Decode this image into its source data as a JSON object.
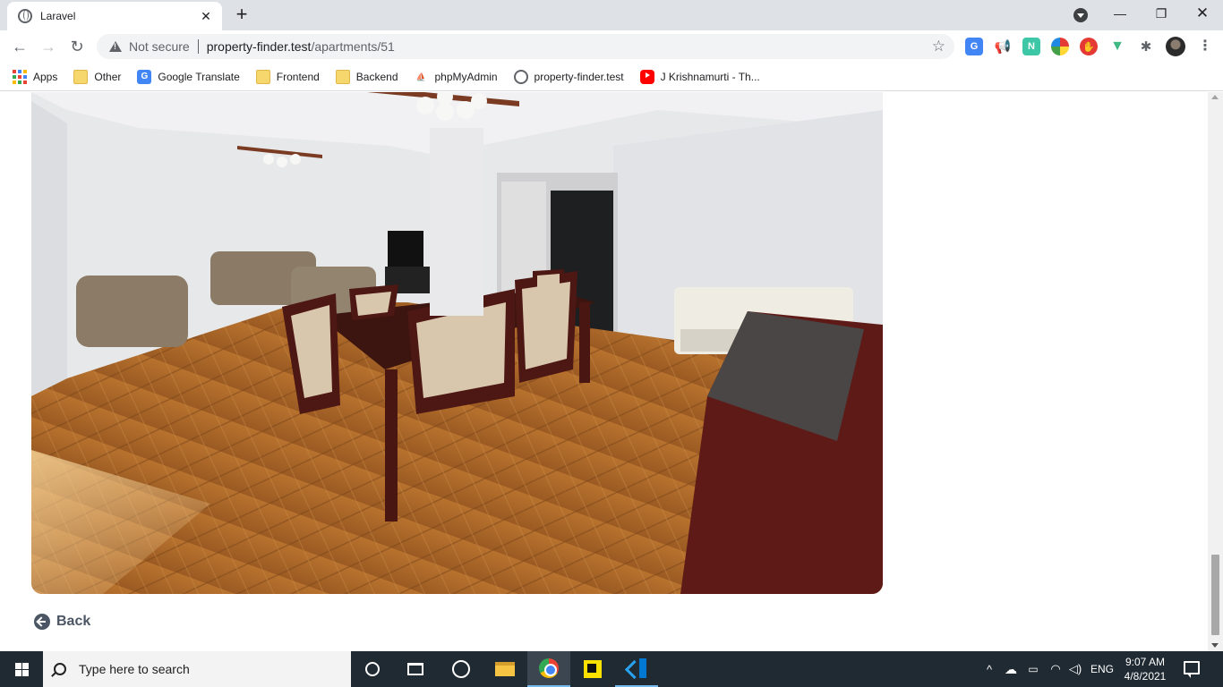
{
  "browser": {
    "tab_title": "Laravel",
    "address": {
      "security_label": "Not secure",
      "host": "property-finder.test",
      "path": "/apartments/51"
    },
    "bookmarks": [
      {
        "label": "Apps",
        "icon": "apps-grid-icon"
      },
      {
        "label": "Other",
        "icon": "folder-icon"
      },
      {
        "label": "Google Translate",
        "icon": "google-translate-icon"
      },
      {
        "label": "Frontend",
        "icon": "folder-icon"
      },
      {
        "label": "Backend",
        "icon": "folder-icon"
      },
      {
        "label": "phpMyAdmin",
        "icon": "phpmyadmin-icon"
      },
      {
        "label": "property-finder.test",
        "icon": "globe-icon"
      },
      {
        "label": "J Krishnamurti - Th...",
        "icon": "youtube-icon"
      }
    ]
  },
  "page": {
    "photo_alt": "Apartment living and dining room",
    "back_label": "Back"
  },
  "taskbar": {
    "search_placeholder": "Type here to search",
    "language": "ENG",
    "time": "9:07 AM",
    "date": "4/8/2021"
  },
  "colors": {
    "accent": "#4b5563",
    "tabstrip": "#dee1e6",
    "taskbar": "#202a33"
  }
}
